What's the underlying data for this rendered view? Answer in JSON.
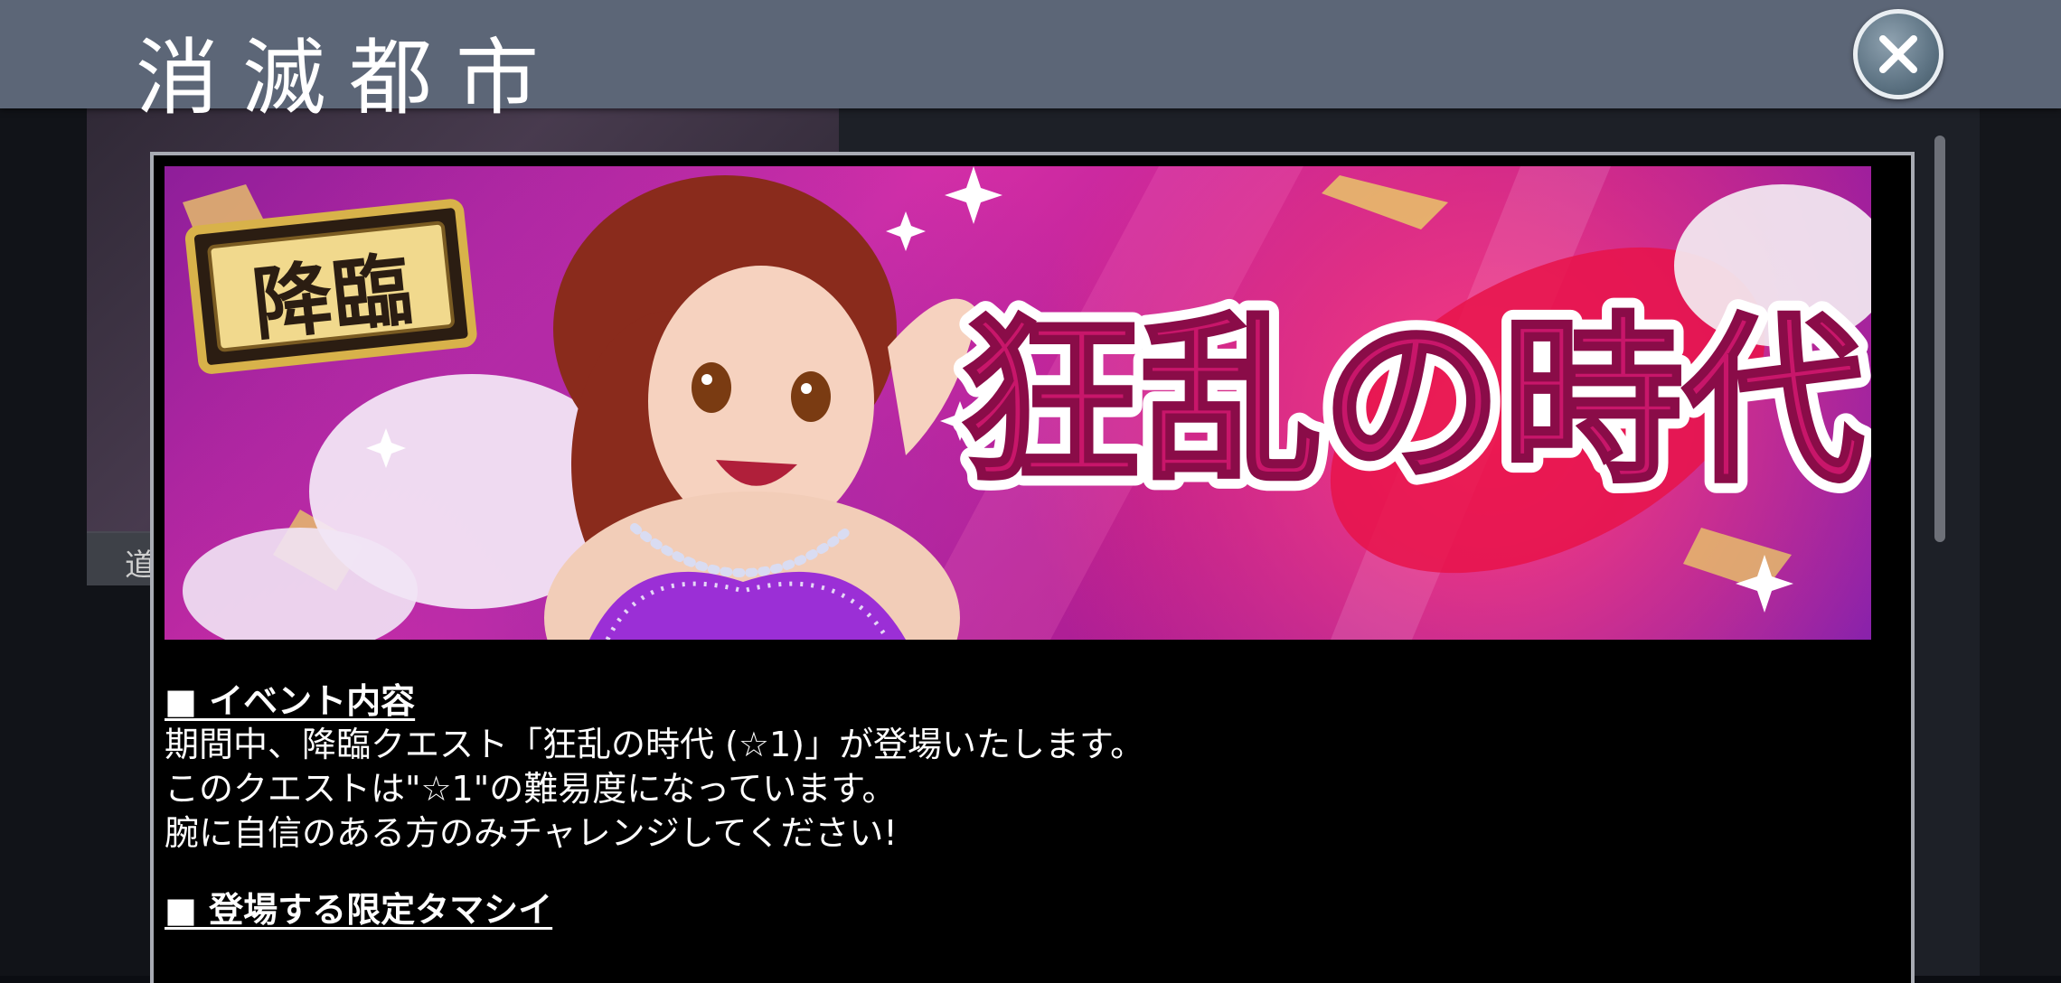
{
  "header": {
    "title": "消滅都市"
  },
  "background": {
    "label": "道"
  },
  "banner": {
    "badge_text": "降臨",
    "title_text": "狂乱の時代"
  },
  "content": {
    "section1_heading": "■ イベント内容",
    "line1": "期間中、降臨クエスト「狂乱の時代 (☆1)」が登場いたします。",
    "line2": "このクエストは\"☆1\"の難易度になっています。",
    "line3": "腕に自信のある方のみチャレンジしてください!",
    "section2_heading": "■ 登場する限定タマシイ"
  },
  "colors": {
    "header_bg": "#5c6677",
    "modal_border": "#a8abb3",
    "banner_title": "#c8166a",
    "badge_gold": "#d8b24a"
  },
  "icons": {
    "close": "close-icon"
  }
}
